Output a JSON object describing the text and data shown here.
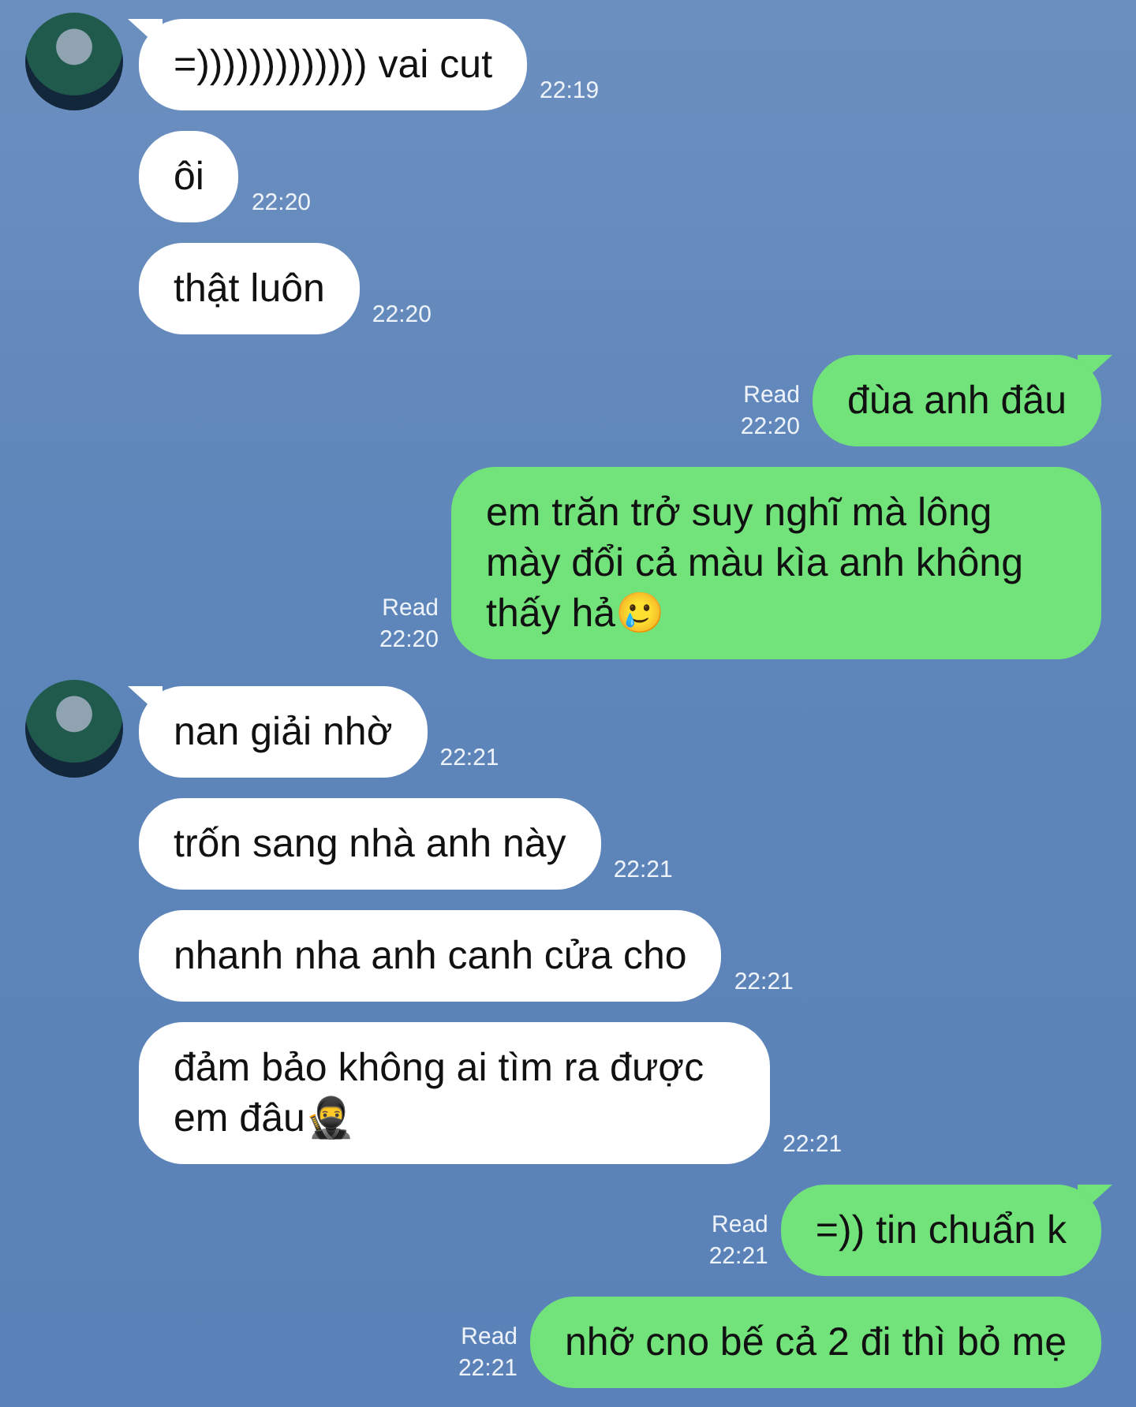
{
  "messages": [
    {
      "kind": "incoming",
      "avatar": true,
      "text": "=))))))))))))) vai cut",
      "time": "22:19"
    },
    {
      "kind": "incoming",
      "avatar": false,
      "text": "ôi",
      "time": "22:20"
    },
    {
      "kind": "incoming",
      "avatar": false,
      "text": "thật luôn",
      "time": "22:20"
    },
    {
      "kind": "outgoing",
      "read": true,
      "read_label": "Read",
      "text": "đùa anh đâu",
      "time": "22:20"
    },
    {
      "kind": "outgoing",
      "read": true,
      "read_label": "Read",
      "text": "em trăn trở suy nghĩ mà lông mày đổi cả màu kìa anh không thấy hả🥲",
      "time": "22:20"
    },
    {
      "kind": "incoming",
      "avatar": true,
      "text": "nan giải nhờ",
      "time": "22:21"
    },
    {
      "kind": "incoming",
      "avatar": false,
      "text": "trốn sang nhà anh này",
      "time": "22:21"
    },
    {
      "kind": "incoming",
      "avatar": false,
      "text": "nhanh nha anh canh cửa cho",
      "time": "22:21"
    },
    {
      "kind": "incoming",
      "avatar": false,
      "text": "đảm bảo không ai tìm ra được em đâu🥷",
      "time": "22:21"
    },
    {
      "kind": "outgoing",
      "read": true,
      "read_label": "Read",
      "text": "=)) tin chuẩn k",
      "time": "22:21"
    },
    {
      "kind": "outgoing",
      "read": true,
      "read_label": "Read",
      "text": "nhỡ cno bế cả 2 đi thì bỏ mẹ",
      "time": "22:21"
    }
  ]
}
